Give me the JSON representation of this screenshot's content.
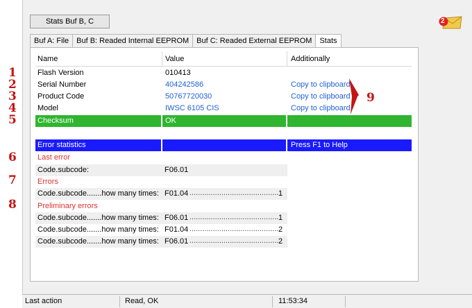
{
  "window": {
    "title_button": "Stats Buf B, C",
    "mail_badge": "2"
  },
  "tabs": [
    "Buf A: File",
    "Buf B: Readed Internal EEPROM",
    "Buf C: Readed External EEPROM",
    "Stats"
  ],
  "table": {
    "headers": {
      "name": "Name",
      "value": "Value",
      "additional": "Additionally"
    },
    "rows": [
      {
        "name": "Flash Version",
        "value": "010413",
        "extra": ""
      },
      {
        "name": "Serial Number",
        "value": "404242586",
        "extra": "Copy to clipboard"
      },
      {
        "name": "Product Code",
        "value": "50767720030",
        "extra": "Copy to clipboard"
      },
      {
        "name": "Model",
        "value": "IWSC 6105 CIS",
        "extra": "Copy to clipboard"
      }
    ],
    "checksum": {
      "name": "Checksum",
      "value": "OK"
    },
    "error_header": {
      "name": "Error statistics",
      "extra": "Press F1 to Help"
    },
    "last_error": {
      "label": "Last error",
      "row": {
        "name": "Code.subcode:",
        "value": "F06.01"
      }
    },
    "errors": {
      "label": "Errors",
      "rows": [
        {
          "name": "Code.subcode.......how many times:",
          "code": "F01.04",
          "count": "1"
        }
      ]
    },
    "preliminary": {
      "label": "Preliminary errors",
      "rows": [
        {
          "name": "Code.subcode.......how many times:",
          "code": "F06.01",
          "count": "1"
        },
        {
          "name": "Code.subcode.......how many times:",
          "code": "F01.04",
          "count": "2"
        },
        {
          "name": "Code.subcode.......how many times:",
          "code": "F06.01",
          "count": "2"
        }
      ]
    }
  },
  "annotations": [
    "1",
    "2",
    "3",
    "4",
    "5",
    "6",
    "7",
    "8",
    "9"
  ],
  "status": {
    "label": "Last action",
    "message": "Read, OK",
    "time": "11:53:34"
  },
  "colors": {
    "checksum_bar": "#2fb52f",
    "error_bar": "#1a1aff",
    "link": "#1f5fd6",
    "annotation": "#c41414"
  }
}
